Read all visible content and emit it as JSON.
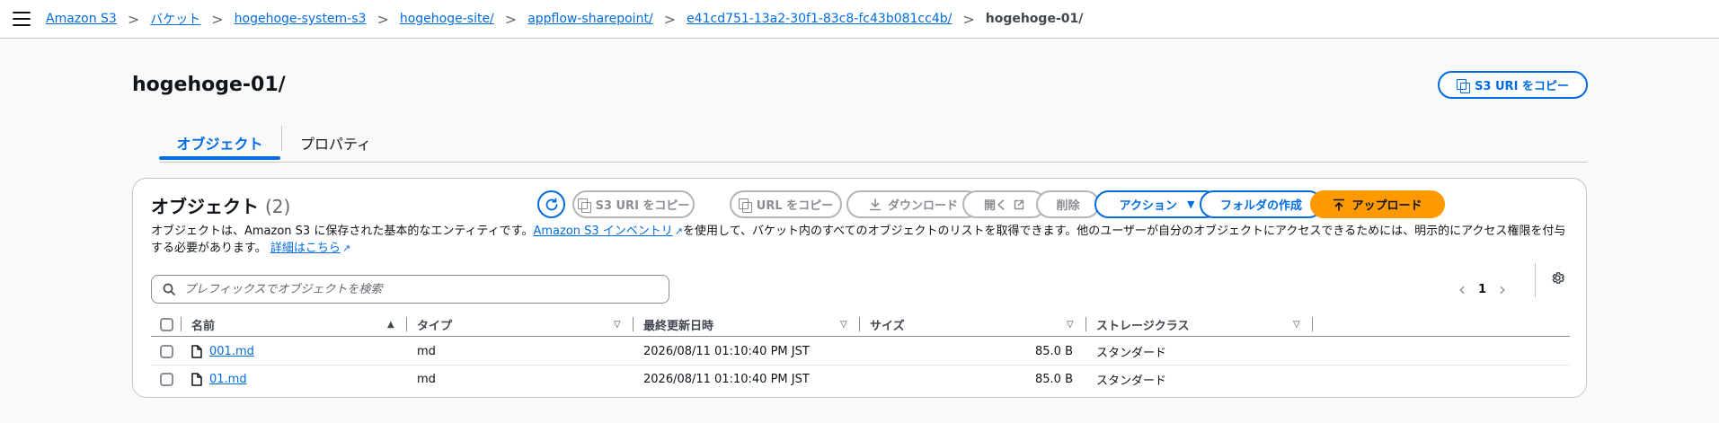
{
  "breadcrumb": {
    "items": [
      "Amazon S3",
      "バケット",
      "hogehoge-system-s3",
      "hogehoge-site/",
      "appflow-sharepoint/",
      "e41cd751-13a2-30f1-83c8-fc43b081cc4b/"
    ],
    "current": "hogehoge-01/",
    "separator": ">"
  },
  "page": {
    "title": "hogehoge-01/",
    "copy_uri_label": "S3 URI をコピー"
  },
  "tabs": [
    {
      "label": "オブジェクト",
      "active": true
    },
    {
      "label": "プロパティ",
      "active": false
    }
  ],
  "objects": {
    "title": "オブジェクト",
    "count": "(2)",
    "description_before": "オブジェクトは、Amazon S3 に保存された基本的なエンティティです。",
    "inventory_link": "Amazon S3 インベントリ",
    "description_middle": "を使用して、バケット内のすべてのオブジェクトのリストを取得できます。他のユーザーが自分のオブジェクトにアクセスできるためには、明示的にアクセス権限を付与する必要があります。",
    "learn_more_link": "詳細はこちら",
    "buttons": {
      "copy_s3_uri": "S3 URI をコピー",
      "copy_url": "URL をコピー",
      "download": "ダウンロード",
      "open": "開く",
      "delete": "削除",
      "actions": "アクション",
      "create_folder": "フォルダの作成",
      "upload": "アップロード"
    },
    "search_placeholder": "プレフィックスでオブジェクトを検索",
    "pagination": {
      "current_page": "1"
    },
    "columns": [
      "名前",
      "タイプ",
      "最終更新日時",
      "サイズ",
      "ストレージクラス"
    ],
    "rows": [
      {
        "name": "001.md",
        "type": "md",
        "modified": "2026/08/11 01:10:40 PM JST",
        "size": "85.0 B",
        "storage_class": "スタンダード"
      },
      {
        "name": "01.md",
        "type": "md",
        "modified": "2026/08/11 01:10:40 PM JST",
        "size": "85.0 B",
        "storage_class": "スタンダード"
      }
    ]
  },
  "colors": {
    "link": "#006ce0",
    "primary": "#ff9900",
    "border": "#c6c6cd",
    "disabled": "#b4b4bb"
  },
  "icons": [
    "menu-icon",
    "copy-icon",
    "refresh-icon",
    "download-icon",
    "external-link-icon",
    "caret-down-icon",
    "upload-icon",
    "search-icon",
    "chevron-left-icon",
    "chevron-right-icon",
    "settings-icon",
    "file-icon",
    "sort-ascending-icon",
    "sort-icon"
  ]
}
